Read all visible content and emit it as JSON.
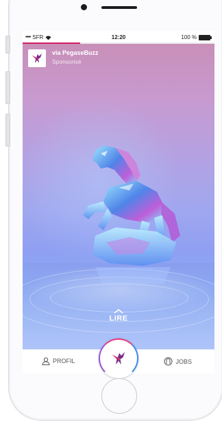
{
  "status_bar": {
    "carrier": "SFR",
    "signal_dots": "•••••",
    "time": "12:20",
    "battery_text": "100 %",
    "story_progress": 0.3
  },
  "ad": {
    "sponsor_name": "via PegaseBuzz",
    "sponsor_label": "Sponsorisé",
    "cta_label": "LIRE"
  },
  "bottom_nav": {
    "profile_label": "PROFIL",
    "jobs_label": "JOBS"
  },
  "colors": {
    "accent": "#d21e63",
    "logo_purple": "#7a2d8c",
    "logo_pink": "#e23a6e"
  },
  "icons": [
    "wifi-icon",
    "battery-icon",
    "pegasus-logo-icon",
    "chevron-up-icon",
    "person-icon",
    "jobs-icon"
  ]
}
